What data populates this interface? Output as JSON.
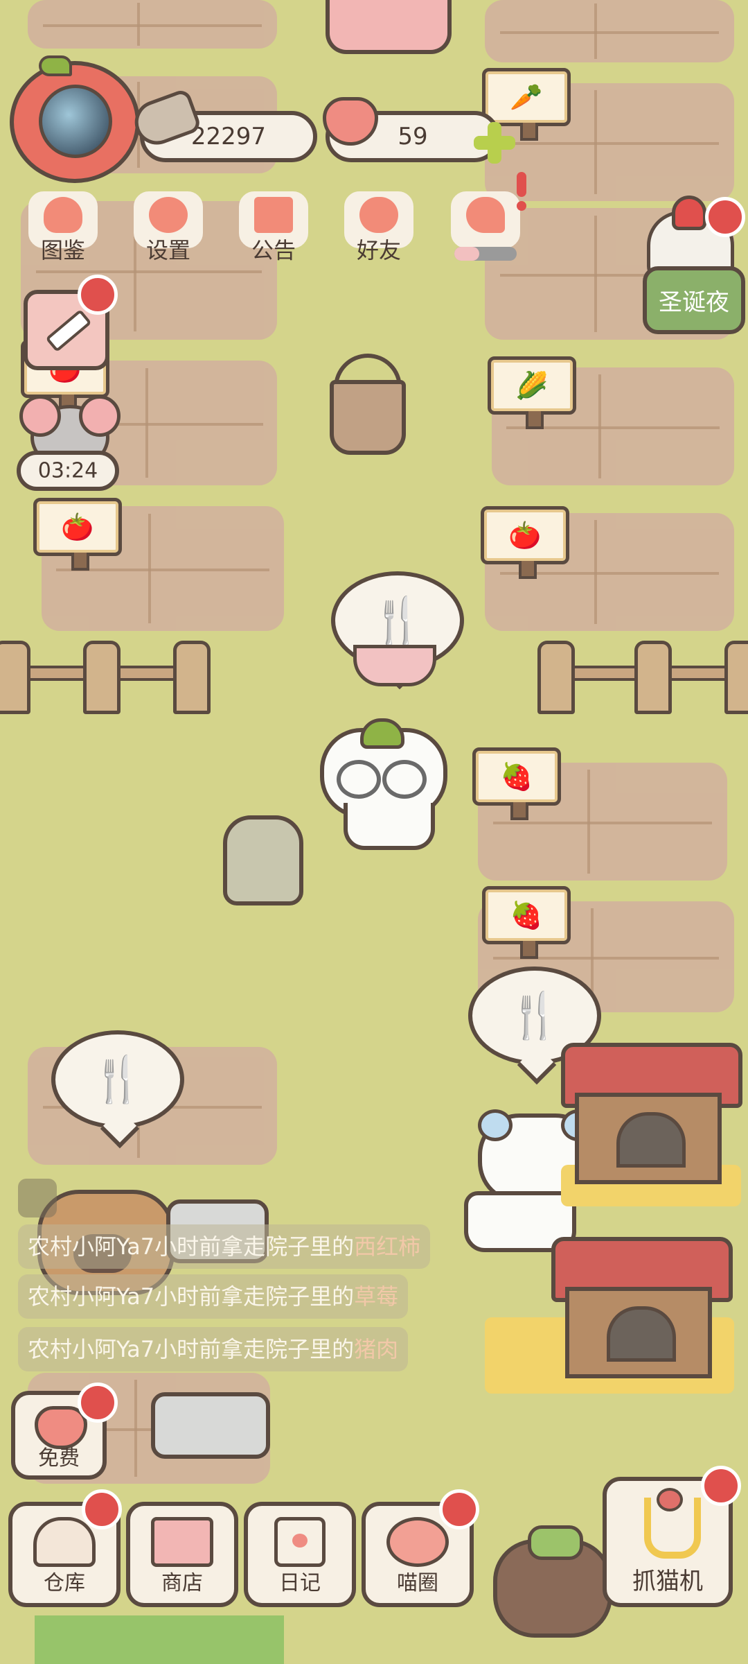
{
  "header": {
    "coins": "22297",
    "hearts": "59",
    "plus_label": "+"
  },
  "top_menu": [
    {
      "label": "图鉴",
      "icon": "cat-book-icon"
    },
    {
      "label": "设置",
      "icon": "gear-icon"
    },
    {
      "label": "公告",
      "icon": "gift-icon"
    },
    {
      "label": "好友",
      "icon": "friends-icon"
    },
    {
      "label": "",
      "icon": "heart-hands-icon"
    }
  ],
  "event": {
    "label": "圣诞夜"
  },
  "timer": {
    "value": "03:24"
  },
  "feed": [
    {
      "prefix": "农村小阿Ya7小时前拿走院子里的",
      "item": "西红柿"
    },
    {
      "prefix": "农村小阿Ya7小时前拿走院子里的",
      "item": "草莓"
    },
    {
      "prefix": "农村小阿Ya7小时前拿走院子里的",
      "item": "猪肉"
    }
  ],
  "free_button": {
    "label": "免费"
  },
  "bottom_bar": [
    {
      "label": "仓库",
      "icon": "storage-icon"
    },
    {
      "label": "商店",
      "icon": "shop-icon"
    },
    {
      "label": "日记",
      "icon": "diary-icon"
    },
    {
      "label": "喵圈",
      "icon": "cat-planet-icon"
    }
  ],
  "claw_machine": {
    "label": "抓猫机"
  },
  "colors": {
    "grass": "#d4d48b",
    "soil": "#d2b49c",
    "accent_red": "#e0504d",
    "outline": "#5a4a40",
    "button_bg": "#f7f0e4",
    "event_green": "#8bb06a"
  }
}
